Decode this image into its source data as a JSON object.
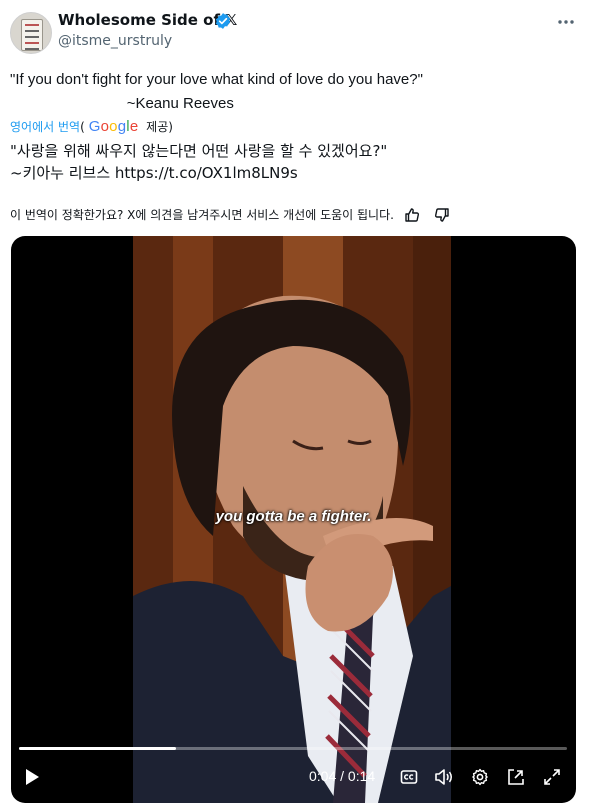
{
  "author": {
    "name": "Wholesome Side of 𝕏",
    "handle": "@itsme_urstruly"
  },
  "tweet": {
    "original_text": "\"If you don't fight for your love what kind of love do you have?\"\n                            ~Keanu Reeves",
    "translated_by_label": "영어에서 번역",
    "paren_open": "(",
    "google_label": "Google",
    "provided_label": " 제공)",
    "translated_text": "\"사랑을 위해 싸우지 않는다면 어떤 사랑을 할 수 있겠어요?\"\n~키아누 리브스 https://t.co/OX1lm8LN9s",
    "feedback_prompt": "이 번역이 정확한가요? X에 의견을 남겨주시면 서비스 개선에 도움이 됩니다."
  },
  "video": {
    "caption": "you gotta be a fighter.",
    "current_time": "0:04",
    "separator": " / ",
    "duration": "0:14",
    "progress": 0.286
  },
  "icons": {
    "verified": "verified-badge-icon",
    "more": "more-options-icon",
    "thumbs_up": "thumbs-up-icon",
    "thumbs_down": "thumbs-down-icon",
    "play": "play-icon",
    "captions": "captions-icon",
    "volume": "volume-icon",
    "settings": "settings-icon",
    "pop_out": "pop-out-icon",
    "fullscreen": "fullscreen-icon"
  },
  "colors": {
    "link": "#1d9bf0",
    "verified": "#1d9bf0",
    "secondary_text": "#536471"
  }
}
